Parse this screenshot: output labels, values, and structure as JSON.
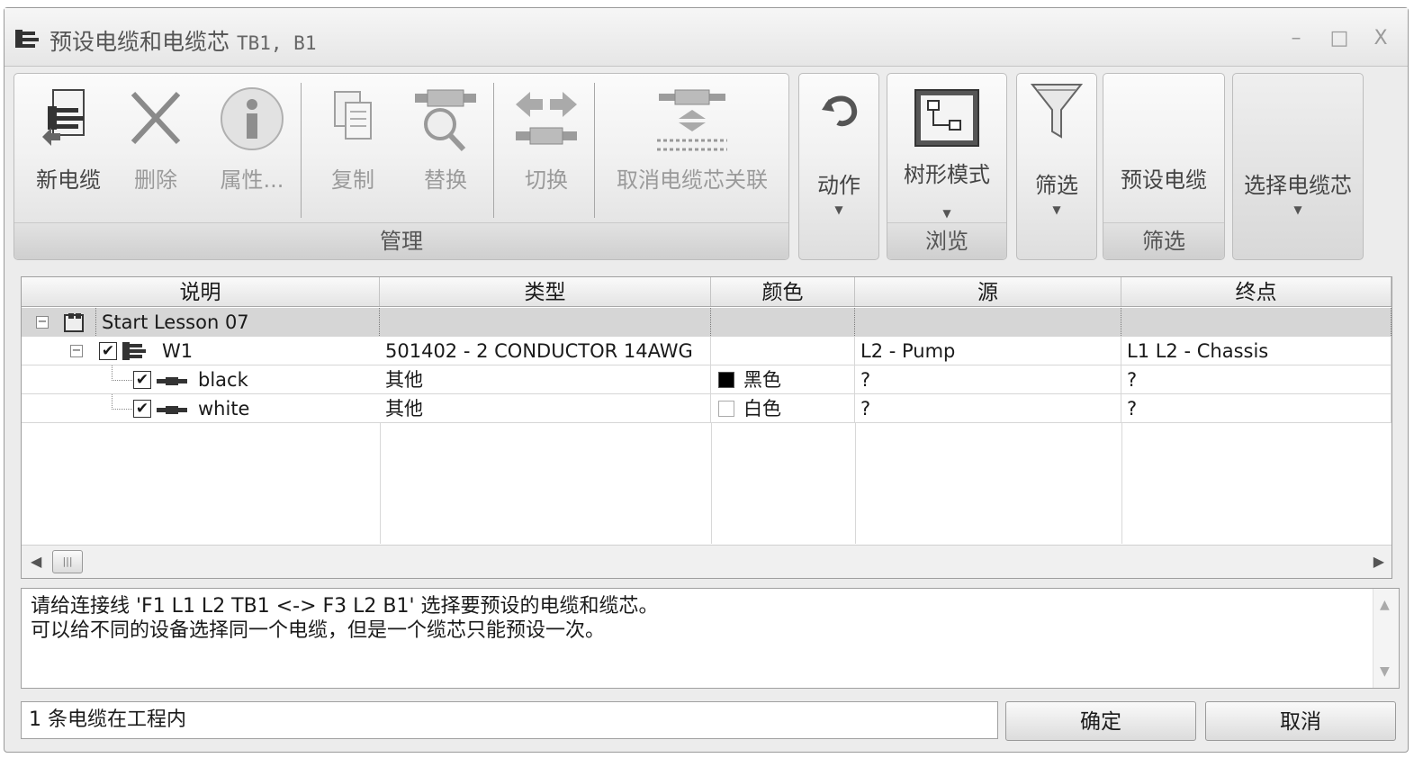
{
  "window": {
    "title": "预设电缆和电缆芯",
    "title_suffix": "TB1, B1",
    "minimize": "–",
    "maximize": "□",
    "close": "X"
  },
  "ribbon": {
    "manage": {
      "label": "管理",
      "new_cable": "新电缆",
      "delete": "删除",
      "properties": "属性...",
      "copy": "复制",
      "replace": "替换",
      "switch": "切换",
      "unlink": "取消电缆芯关联"
    },
    "action": {
      "label": "动作"
    },
    "browse": {
      "tree_mode": "树形模式",
      "label": "浏览"
    },
    "filter": {
      "label": "筛选",
      "group_label": "筛选",
      "preset_cable": "预设电缆"
    },
    "select_core": {
      "label": "选择电缆芯"
    }
  },
  "grid": {
    "columns": [
      "说明",
      "类型",
      "颜色",
      "源",
      "终点"
    ],
    "rows": [
      {
        "desc": "Start Lesson 07",
        "type": "",
        "color": "",
        "source": "",
        "dest": ""
      },
      {
        "desc": "W1",
        "type": "501402 - 2 CONDUCTOR 14AWG",
        "color": "",
        "source": "L2 - Pump",
        "dest": "L1 L2 - Chassis"
      },
      {
        "desc": "black",
        "type": "其他",
        "color": "黑色",
        "source": "?",
        "dest": "?"
      },
      {
        "desc": "white",
        "type": "其他",
        "color": "白色",
        "source": "?",
        "dest": "?"
      }
    ],
    "swatch_colors": {
      "black": "#000000",
      "white": "#ffffff"
    }
  },
  "message": {
    "line1": "请给连接线 'F1 L1 L2 TB1 <-> F3 L2 B1' 选择要预设的电缆和缆芯。",
    "line2": "可以给不同的设备选择同一个电缆，但是一个缆芯只能预设一次。"
  },
  "status": "1 条电缆在工程内",
  "buttons": {
    "ok": "确定",
    "cancel": "取消"
  }
}
